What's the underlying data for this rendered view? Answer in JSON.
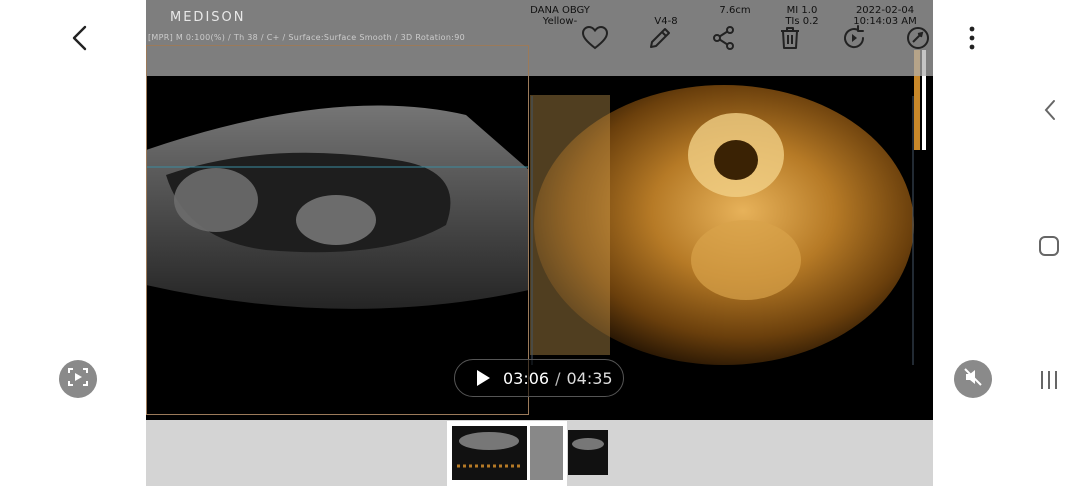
{
  "header": {
    "brand": "MEDISON",
    "patient_name": "DANA OBGY",
    "patient_sub": "Yellow-",
    "probe": "V4-8",
    "depth": "7.6cm",
    "mi": "MI 1.0",
    "tis": "TIs 0.2",
    "date": "2022-02-04",
    "time": "10:14:03 AM",
    "mpr_info": "[MPR]  M 0:100(%) / Th 38 / C+ / Surface:Surface Smooth / 3D Rotation:90"
  },
  "toolbar": {
    "icons": [
      "back-icon",
      "heart-icon",
      "edit-icon",
      "share-icon",
      "delete-icon",
      "rotate-icon",
      "more-options-icon"
    ]
  },
  "player": {
    "current_time": "03:06",
    "separator": "/",
    "duration": "04:35"
  },
  "colors": {
    "accent_gold": "#c8882a",
    "overlay_gray": "#afafaf",
    "nav_gray": "#8a8a8a"
  }
}
